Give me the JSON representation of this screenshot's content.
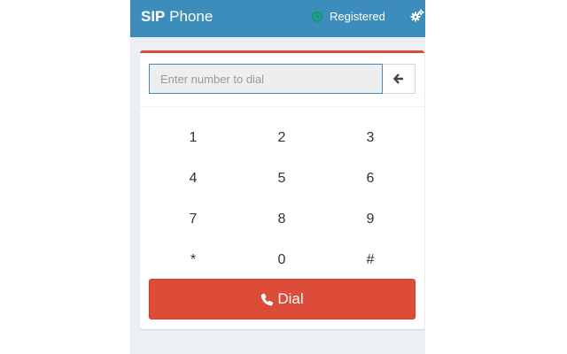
{
  "header": {
    "brand_bold": "SIP",
    "brand_rest": "Phone",
    "status": "Registered",
    "status_icon": "circle-dot-icon",
    "settings_icon": "cogs-icon"
  },
  "dialer": {
    "placeholder": "Enter number to dial",
    "value": "",
    "backspace_icon": "arrow-left-icon"
  },
  "keypad": {
    "keys": [
      "1",
      "2",
      "3",
      "4",
      "5",
      "6",
      "7",
      "8",
      "9",
      "*",
      "0",
      "#"
    ]
  },
  "dial_button": {
    "label": "Dial",
    "icon": "phone-icon"
  },
  "colors": {
    "header_bg": "#3c8dbc",
    "page_bg": "#ecf0f5",
    "accent": "#dd4b39",
    "status_ok": "#00a65a"
  }
}
